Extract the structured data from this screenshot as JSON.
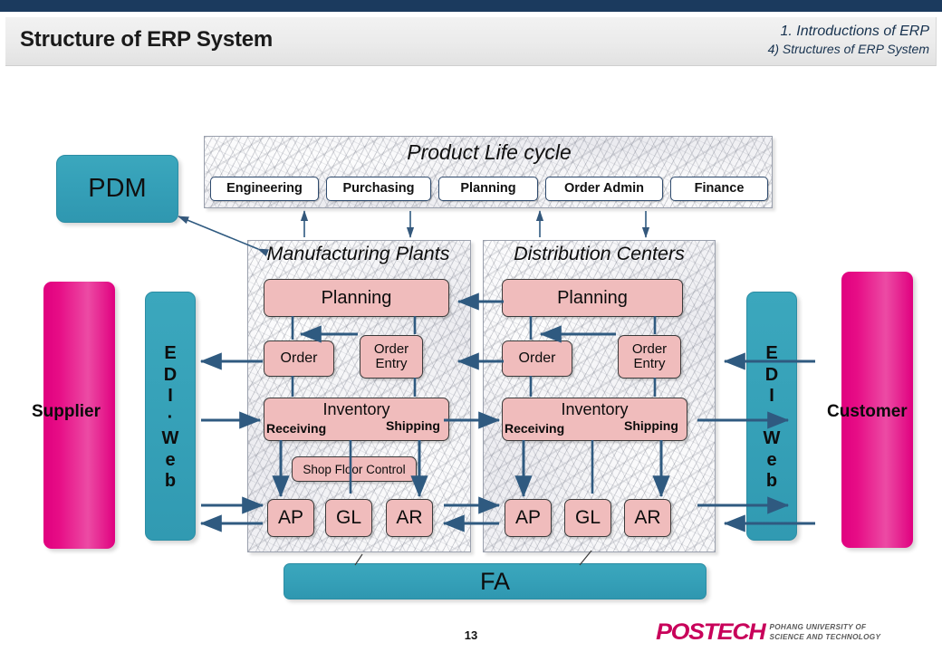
{
  "header": {
    "title": "Structure of ERP System",
    "section_line1": "1. Introductions of ERP",
    "section_line2": "4) Structures of ERP System"
  },
  "product_life_cycle": {
    "title": "Product  Life cycle",
    "items": [
      "Engineering",
      "Purchasing",
      "Planning",
      "Order Admin",
      "Finance"
    ]
  },
  "pdm": {
    "label": "PDM"
  },
  "panels": [
    {
      "title": "Manufacturing Plants",
      "boxes": {
        "planning": "Planning",
        "order": "Order",
        "order_entry": "Order\nEntry",
        "order_entry_line1": "Order",
        "order_entry_line2": "Entry",
        "inventory": "Inventory",
        "receiving": "Receiving",
        "shipping": "Shipping",
        "shop_floor_control": "Shop Floor Control",
        "ap": "AP",
        "gl": "GL",
        "ar": "AR"
      }
    },
    {
      "title": "Distribution Centers",
      "boxes": {
        "planning": "Planning",
        "order": "Order",
        "order_entry_line1": "Order",
        "order_entry_line2": "Entry",
        "inventory": "Inventory",
        "receiving": "Receiving",
        "shipping": "Shipping",
        "ap": "AP",
        "gl": "GL",
        "ar": "AR"
      }
    }
  ],
  "left_side": {
    "actor": "Supplier",
    "channel_letters": [
      "E",
      "D",
      "I",
      "·",
      "W",
      "e",
      "b"
    ]
  },
  "right_side": {
    "actor": "Customer",
    "channel_letters": [
      "E",
      "D",
      "I",
      "·",
      "W",
      "e",
      "b"
    ]
  },
  "fa": {
    "label": "FA"
  },
  "footer": {
    "page_number": "13",
    "logo_text": "POSTECH",
    "logo_sub_line1": "POHANG UNIVERSITY OF",
    "logo_sub_line2": "SCIENCE AND TECHNOLOGY"
  },
  "colors": {
    "topbar": "#1b3a5e",
    "teal": "#35a0b8",
    "magenta": "#e0007f",
    "pink_box": "#f0bcbc",
    "arrow": "#2f5a80",
    "logo": "#c8005a"
  }
}
